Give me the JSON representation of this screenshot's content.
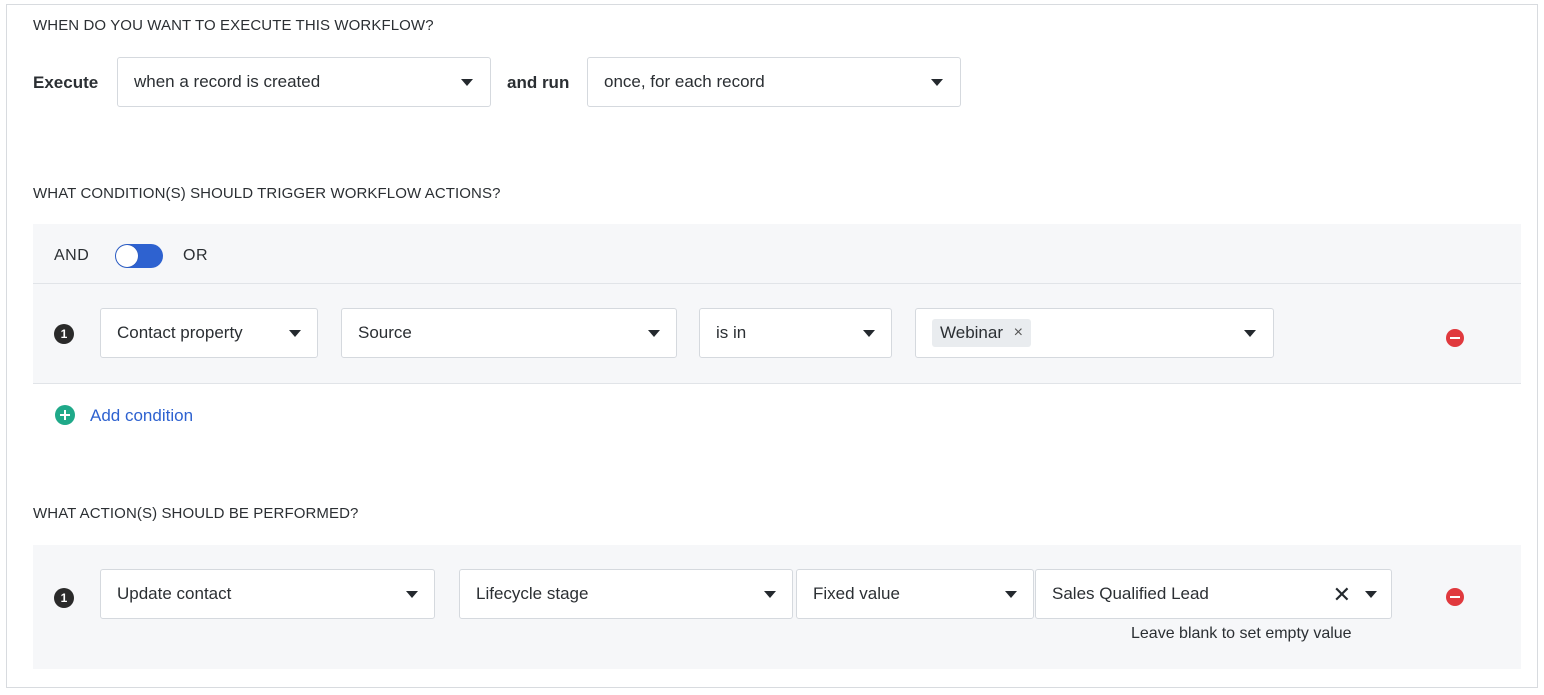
{
  "execute_section": {
    "heading": "WHEN DO YOU WANT TO EXECUTE THIS WORKFLOW?",
    "execute_label": "Execute",
    "execute_value": "when a record is created",
    "and_run_label": "and run",
    "run_value": "once, for each record"
  },
  "conditions_section": {
    "heading": "WHAT CONDITION(S) SHOULD TRIGGER WORKFLOW ACTIONS?",
    "and_label": "AND",
    "or_label": "OR",
    "rows": [
      {
        "number": "1",
        "type": "Contact property",
        "property": "Source",
        "operator": "is in",
        "value_tag": "Webinar",
        "tag_remove": "×"
      }
    ],
    "add_condition_label": "Add condition"
  },
  "actions_section": {
    "heading": "WHAT ACTION(S) SHOULD BE PERFORMED?",
    "rows": [
      {
        "number": "1",
        "action": "Update contact",
        "field": "Lifecycle stage",
        "value_type": "Fixed value",
        "value": "Sales Qualified Lead",
        "clear_glyph": "✕",
        "hint": "Leave blank to set empty value"
      }
    ]
  },
  "colors": {
    "accent_blue": "#2e62d0",
    "add_green": "#1fa989",
    "remove_red": "#e0393e",
    "panel_bg": "#f6f7f9"
  }
}
